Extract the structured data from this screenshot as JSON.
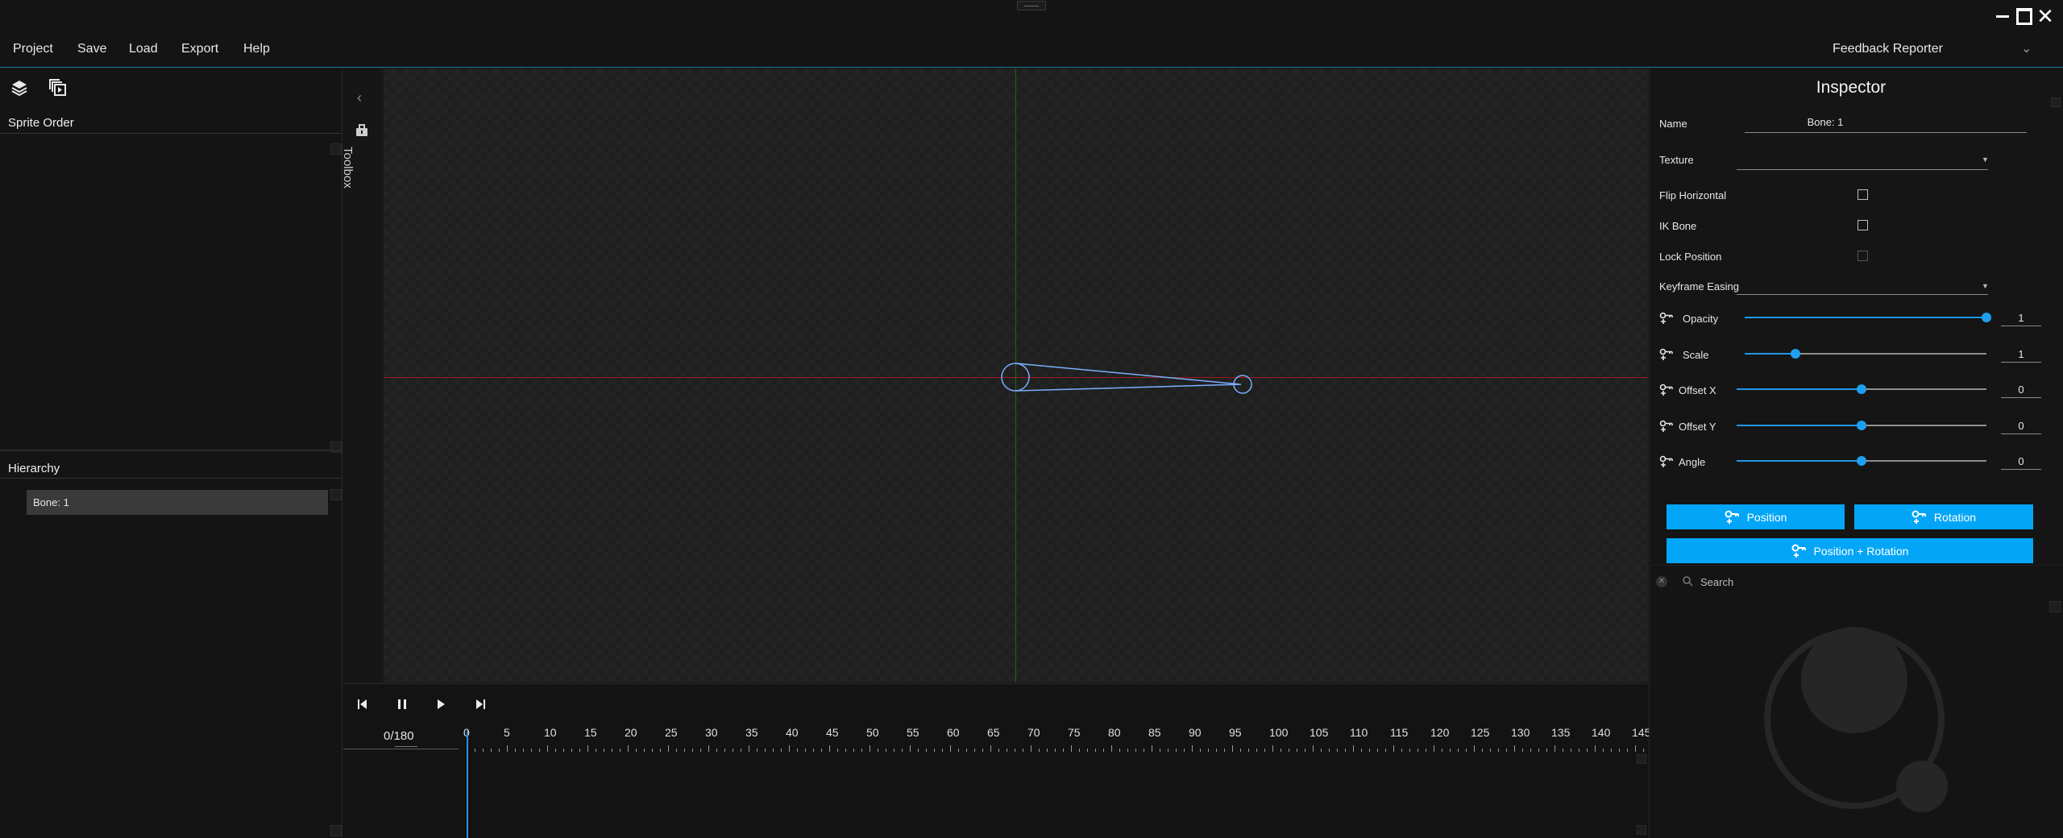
{
  "menu": {
    "project": "Project",
    "save": "Save",
    "load": "Load",
    "export": "Export",
    "help": "Help",
    "feedback": "Feedback Reporter"
  },
  "left_panel": {
    "sprite_order_title": "Sprite Order",
    "hierarchy_title": "Hierarchy",
    "hierarchy_items": [
      "Bone: 1"
    ]
  },
  "toolbox": {
    "label": "Toolbox"
  },
  "timeline": {
    "frame_counter": "0/180",
    "current_frame": 0,
    "total_frames": 180,
    "ruler_labels": [
      "0",
      "5",
      "10",
      "15",
      "20",
      "25",
      "30",
      "35",
      "40",
      "45",
      "50",
      "55",
      "60",
      "65",
      "70",
      "75",
      "80",
      "85",
      "90",
      "95",
      "100",
      "105",
      "110",
      "115",
      "120",
      "125",
      "130",
      "135",
      "140",
      "145"
    ]
  },
  "inspector": {
    "title": "Inspector",
    "name_label": "Name",
    "name_value": "Bone: 1",
    "texture_label": "Texture",
    "texture_value": "",
    "flip_label": "Flip Horizontal",
    "flip_checked": false,
    "ik_label": "IK Bone",
    "ik_checked": false,
    "lock_label": "Lock Position",
    "lock_checked": false,
    "easing_label": "Keyframe Easing",
    "easing_value": "",
    "sliders": [
      {
        "label": "Opacity",
        "value": "1",
        "fraction": 1.0
      },
      {
        "label": "Scale",
        "value": "1",
        "fraction": 0.21
      },
      {
        "label": "Offset X",
        "value": "0",
        "fraction": 0.5
      },
      {
        "label": "Offset Y",
        "value": "0",
        "fraction": 0.5
      },
      {
        "label": "Angle",
        "value": "0",
        "fraction": 0.5
      }
    ],
    "btn_position": "Position",
    "btn_rotation": "Rotation",
    "btn_position_rotation": "Position + Rotation"
  },
  "browser": {
    "search_placeholder": "Search"
  },
  "colors": {
    "accent": "#03a6f7",
    "x_axis": "#9b1b1b",
    "y_axis": "#1c6b1c",
    "bone": "#7ab0ff"
  }
}
